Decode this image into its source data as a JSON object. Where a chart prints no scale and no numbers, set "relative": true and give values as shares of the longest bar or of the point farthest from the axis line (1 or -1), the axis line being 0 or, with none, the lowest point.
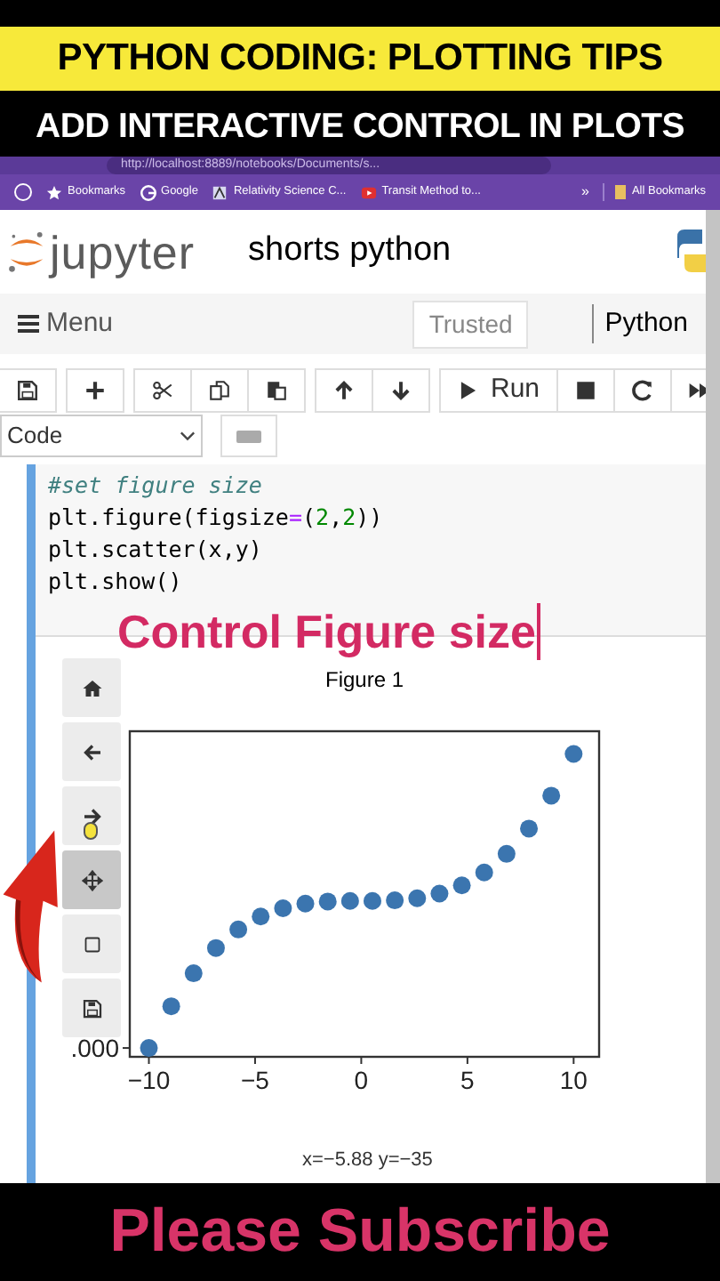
{
  "overlay": {
    "title": "PYTHON CODING: PLOTTING TIPS",
    "subtitle": "ADD INTERACTIVE CONTROL IN PLOTS",
    "caption": "Control Figure size",
    "footer": "Please Subscribe"
  },
  "browser": {
    "url": "http://localhost:8889/notebooks/Documents/s...",
    "bookmarks": [
      {
        "label": "Bookmarks",
        "kind": "star"
      },
      {
        "label": "Google",
        "kind": "google"
      },
      {
        "label": "Relativity Science C...",
        "kind": "site"
      },
      {
        "label": "Transit Method to...",
        "kind": "video"
      }
    ],
    "overflow": "»",
    "all_bookmarks": "All Bookmarks"
  },
  "notebook": {
    "logo_text": "jupyter",
    "title": "shorts python",
    "menu": "Menu",
    "trusted": "Trusted",
    "kernel": "Python",
    "toolbar_groups": [
      [
        {
          "kind": "save"
        }
      ],
      [
        {
          "kind": "add"
        }
      ],
      [
        {
          "kind": "cut"
        },
        {
          "kind": "copy"
        },
        {
          "kind": "paste"
        }
      ],
      [
        {
          "kind": "up"
        },
        {
          "kind": "down"
        }
      ],
      [
        {
          "kind": "run",
          "label": "Run"
        },
        {
          "kind": "stop"
        },
        {
          "kind": "restart"
        },
        {
          "kind": "fast-forward"
        }
      ]
    ],
    "cell_type": "Code",
    "code": [
      [
        {
          "text": "#set figure size",
          "kind": "comment"
        }
      ],
      [
        {
          "text": "plt.figure(figsize",
          "kind": "name"
        },
        {
          "text": "=",
          "kind": "operator"
        },
        {
          "text": "(",
          "kind": "name"
        },
        {
          "text": "2",
          "kind": "number"
        },
        {
          "text": ",",
          "kind": "name"
        },
        {
          "text": "2",
          "kind": "number"
        },
        {
          "text": "))",
          "kind": "name"
        }
      ],
      [
        {
          "text": "plt.scatter(x,y)",
          "kind": "name"
        }
      ],
      [
        {
          "text": "plt.show()",
          "kind": "name"
        }
      ]
    ]
  },
  "figure": {
    "title": "Figure 1",
    "tools": [
      {
        "kind": "home",
        "selected": false
      },
      {
        "kind": "back",
        "selected": false
      },
      {
        "kind": "forward",
        "selected": false
      },
      {
        "kind": "move",
        "selected": true
      },
      {
        "kind": "zoom",
        "selected": false
      },
      {
        "kind": "save",
        "selected": false
      }
    ],
    "chart_data": {
      "type": "scatter",
      "x": [
        -10,
        -8.947,
        -7.895,
        -6.842,
        -5.789,
        -4.737,
        -3.684,
        -2.632,
        -1.579,
        -0.526,
        0.526,
        1.579,
        2.632,
        3.684,
        4.737,
        5.789,
        6.842,
        7.895,
        8.947,
        10
      ],
      "series": [
        {
          "color": "#3b75af",
          "values": [
            0,
            0.142,
            0.254,
            0.34,
            0.403,
            0.447,
            0.475,
            0.491,
            0.498,
            0.5,
            0.5,
            0.502,
            0.509,
            0.525,
            0.553,
            0.597,
            0.66,
            0.746,
            0.858,
            1
          ]
        }
      ],
      "xlim": [
        -10.9,
        11.2
      ],
      "xticks": [
        -10,
        -5,
        0,
        5,
        10
      ],
      "relative": true,
      "annotations": [
        {
          "text": ".000"
        }
      ]
    },
    "coords": "x=−5.88 y=−35"
  }
}
